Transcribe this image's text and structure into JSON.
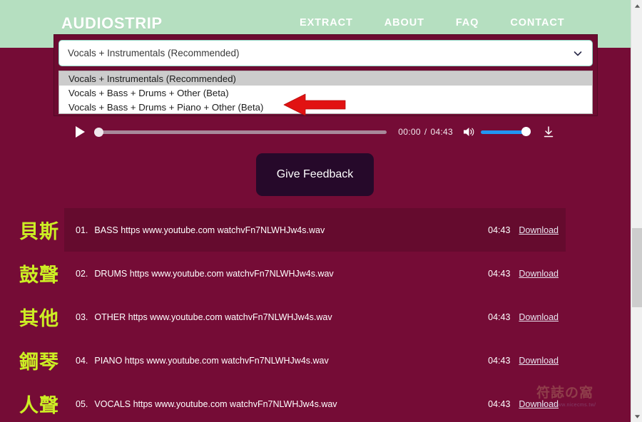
{
  "header": {
    "logo": "AUDIOSTRIP",
    "nav": [
      {
        "label": "EXTRACT"
      },
      {
        "label": "ABOUT"
      },
      {
        "label": "FAQ"
      },
      {
        "label": "CONTACT"
      }
    ],
    "bg_color": "#b5dfc0"
  },
  "select": {
    "value": "Vocals + Instrumentals (Recommended)",
    "chevron_icon": "chevron-down-icon",
    "options": [
      {
        "label": "Vocals + Instrumentals (Recommended)",
        "selected": true
      },
      {
        "label": "Vocals + Bass + Drums + Other (Beta)",
        "selected": false
      },
      {
        "label": "Vocals + Bass + Drums + Piano + Other (Beta)",
        "selected": false
      }
    ]
  },
  "annotation": {
    "arrow_color": "#e11212",
    "arrow_direction": "left",
    "points_at": "Vocals + Bass + Drums + Piano + Other (Beta)"
  },
  "player": {
    "play_icon": "play-icon",
    "current_time": "00:00",
    "separator": "/",
    "total_time": "04:43",
    "progress_percent": 0,
    "volume_icon": "volume-icon",
    "volume_percent": 100,
    "volume_color": "#2196f3",
    "download_icon": "download-icon"
  },
  "feedback": {
    "label": "Give Feedback",
    "bg_color": "#26092a"
  },
  "tracks": {
    "cjk_color": "#ccee24",
    "download_label": "Download",
    "rows": [
      {
        "cjk": "貝斯",
        "num": "01.",
        "name": "BASS https www.youtube.com watchvFn7NLWHJw4s.wav",
        "duration": "04:43",
        "download": "Download",
        "highlighted": true
      },
      {
        "cjk": "鼓聲",
        "num": "02.",
        "name": "DRUMS https www.youtube.com watchvFn7NLWHJw4s.wav",
        "duration": "04:43",
        "download": "Download",
        "highlighted": false
      },
      {
        "cjk": "其他",
        "num": "03.",
        "name": "OTHER https www.youtube.com watchvFn7NLWHJw4s.wav",
        "duration": "04:43",
        "download": "Download",
        "highlighted": false
      },
      {
        "cjk": "鋼琴",
        "num": "04.",
        "name": "PIANO https www.youtube.com watchvFn7NLWHJw4s.wav",
        "duration": "04:43",
        "download": "Download",
        "highlighted": false
      },
      {
        "cjk": "人聲",
        "num": "05.",
        "name": "VOCALS https www.youtube.com watchvFn7NLWHJw4s.wav",
        "duration": "04:43",
        "download": "Download",
        "highlighted": false
      }
    ]
  },
  "watermark": {
    "chars": "符誌の窩",
    "url": "https://www.nicecms.tw/"
  },
  "scrollbar": {
    "up_icon": "scroll-up-icon",
    "down_icon": "scroll-down-icon"
  },
  "page": {
    "bg_color": "#750c36"
  }
}
